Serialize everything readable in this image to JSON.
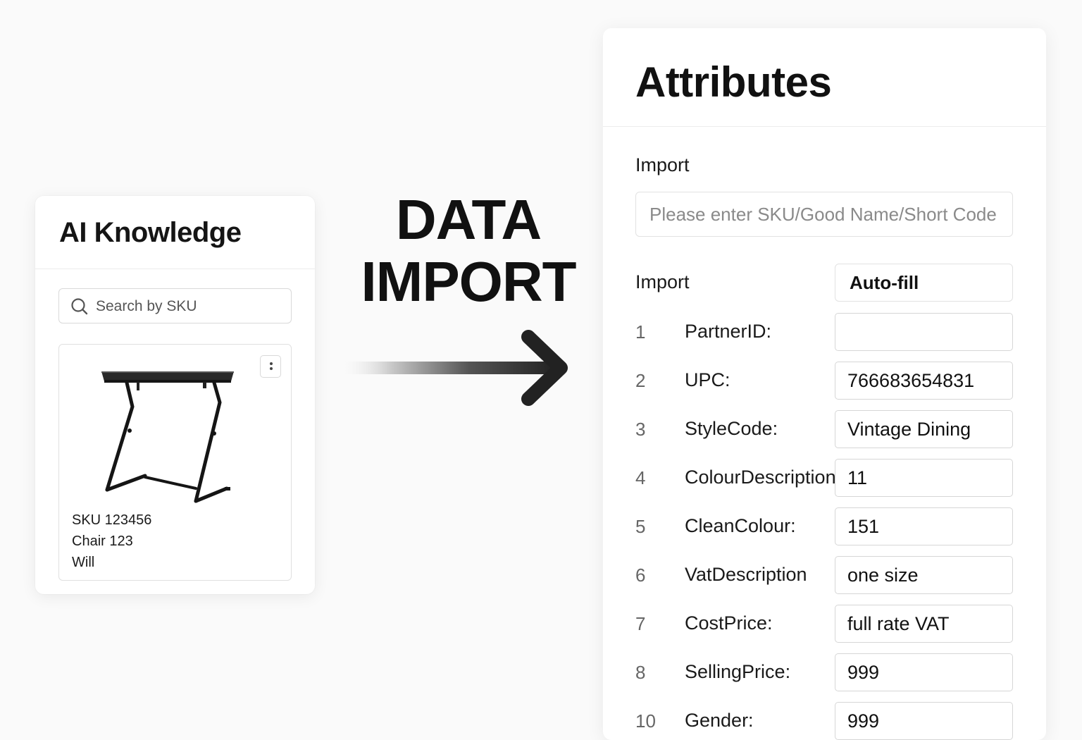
{
  "knowledge": {
    "title": "AI Knowledge",
    "search_placeholder": "Search by SKU",
    "product": {
      "sku": "SKU 123456",
      "name": "Chair 123",
      "owner": "Will",
      "image": "standing-desk-image",
      "menu_icon": "more-vertical-icon"
    }
  },
  "headline": {
    "line1": "DATA",
    "line2": "IMPORT"
  },
  "attributes": {
    "title": "Attributes",
    "import_label": "Import",
    "import_placeholder": "Please enter SKU/Good Name/Short Code",
    "autofill_label": "Import",
    "autofill_button": "Auto-fill",
    "rows": [
      {
        "num": "1",
        "label": "PartnerID:",
        "value": ""
      },
      {
        "num": "2",
        "label": "UPC:",
        "value": "766683654831"
      },
      {
        "num": "3",
        "label": "StyleCode:",
        "value": "Vintage Dining"
      },
      {
        "num": "4",
        "label": "ColourDescription",
        "value": "11"
      },
      {
        "num": "5",
        "label": "CleanColour:",
        "value": "151"
      },
      {
        "num": "6",
        "label": "VatDescription",
        "value": "one size"
      },
      {
        "num": "7",
        "label": "CostPrice:",
        "value": "full rate VAT"
      },
      {
        "num": "8",
        "label": "SellingPrice:",
        "value": "999"
      },
      {
        "num": "10",
        "label": "Gender:",
        "value": "999"
      }
    ]
  }
}
